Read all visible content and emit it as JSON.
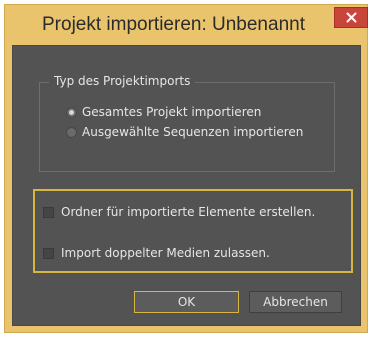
{
  "dialog": {
    "title": "Projekt importieren: Unbenannt",
    "close_icon": "close-icon"
  },
  "import_type": {
    "legend": "Typ des Projektimports",
    "options": [
      {
        "label": "Gesamtes Projekt importieren",
        "selected": true
      },
      {
        "label": "Ausgewählte Sequenzen importieren",
        "selected": false
      }
    ]
  },
  "options": {
    "items": [
      {
        "label": "Ordner für importierte Elemente erstellen.",
        "checked": false
      },
      {
        "label": "Import doppelter Medien zulassen.",
        "checked": false
      }
    ]
  },
  "buttons": {
    "ok": "OK",
    "cancel": "Abbrechen"
  },
  "colors": {
    "frame": "#e9c46d",
    "panel": "#535353",
    "focus_highlight": "#d6b63e",
    "close_button": "#c9443a"
  }
}
